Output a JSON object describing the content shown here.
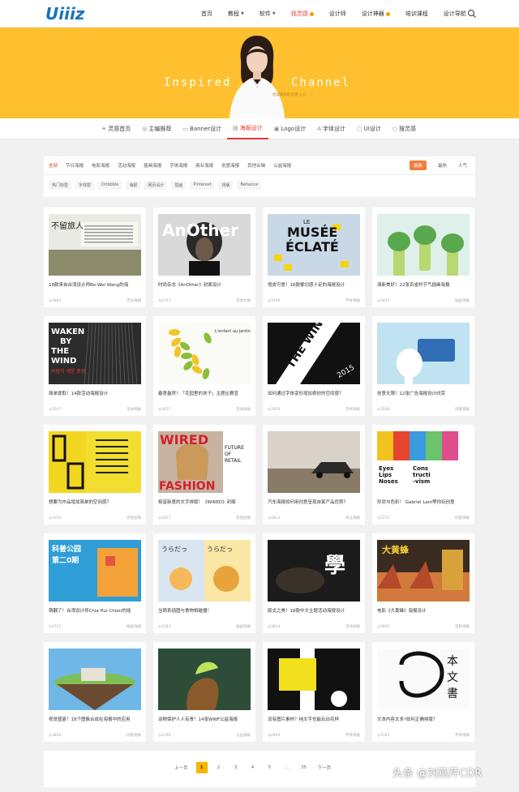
{
  "header": {
    "logo_text": "Uiiiz",
    "nav": [
      {
        "label": "首页",
        "caret": false,
        "badge": false,
        "active": false
      },
      {
        "label": "教程",
        "caret": true,
        "badge": false,
        "active": false
      },
      {
        "label": "软件",
        "caret": true,
        "badge": false,
        "active": false
      },
      {
        "label": "找灵感",
        "caret": false,
        "badge": true,
        "active": true
      },
      {
        "label": "设计师",
        "caret": false,
        "badge": false,
        "active": false
      },
      {
        "label": "设计神器",
        "caret": false,
        "badge": true,
        "active": false
      },
      {
        "label": "培训课程",
        "caret": false,
        "badge": false,
        "active": false
      },
      {
        "label": "设计导航",
        "caret": false,
        "badge": false,
        "active": false
      }
    ],
    "search_icon": "search-icon"
  },
  "banner": {
    "left_text": "Inspired",
    "right_text": "Channel",
    "subtitle": "优设最新的灵感 入口",
    "bg_color": "#fec02f"
  },
  "subnav": [
    {
      "icon": "☀",
      "label": "灵感首页",
      "active": false
    },
    {
      "icon": "◎",
      "label": "主编推荐",
      "active": false
    },
    {
      "icon": "▭",
      "label": "Banner设计",
      "active": false
    },
    {
      "icon": "▤",
      "label": "海报设计",
      "active": true
    },
    {
      "icon": "▣",
      "label": "Logo设计",
      "active": false
    },
    {
      "icon": "A",
      "label": "字体设计",
      "active": false
    },
    {
      "icon": "▢",
      "label": "UI设计",
      "active": false
    },
    {
      "icon": "○",
      "label": "搜灵感",
      "active": false
    }
  ],
  "filter": {
    "tabs": [
      "全部",
      "节日海报",
      "电影海报",
      "活动海报",
      "插画海报",
      "字体海报",
      "商业海报",
      "创意海报",
      "其他合辑",
      "公益海报"
    ],
    "active_tab": 0,
    "sort": [
      "最新",
      "最热",
      "人气"
    ],
    "active_sort": 0,
    "tags": [
      "热门标签",
      "字体帮",
      "Dribbble",
      "海报",
      "网页设计",
      "插画",
      "Pinterest",
      "排版",
      "Behance"
    ]
  },
  "cards": [
    {
      "title": "18款来自台湾设计师Bo-Wei Wang的海",
      "views": "3883",
      "category": "活动海报"
    },
    {
      "title": "时尚杂志《AnOther》封面设计",
      "views": "2743",
      "category": "其他合辑"
    },
    {
      "title": "俏皮可爱！16款紫切感十足的海报设计",
      "views": "3509",
      "category": "字体海报"
    },
    {
      "title": "清新美好！22张百雀羚节气插画海报",
      "views": "3447",
      "category": "插画海报"
    },
    {
      "title": "简单提取！14款活动海报设计",
      "views": "2547",
      "category": "活动海报"
    },
    {
      "title": "春意盎然！「花园里的孩子」主题比赛宣",
      "views": "2827",
      "category": "活动海报"
    },
    {
      "title": "如何通过字体变形增加奇妙的空间感？",
      "views": "2929",
      "category": "字体海报"
    },
    {
      "title": "创意无限！12张广告海报设计欣赏",
      "views": "3508",
      "category": "创意海报"
    },
    {
      "title": "想要为作品增加简单的空间感？",
      "views": "3356",
      "category": "其他合辑"
    },
    {
      "title": "极富新意的文字排版！《WIRED》封面",
      "views": "2827",
      "category": "其他合辑"
    },
    {
      "title": "汽车海报如何用创意呈现自家产品优势？",
      "views": "2813",
      "category": "商业海报"
    },
    {
      "title": "形状与色彩！ Gabriel Lam等你玩创意",
      "views": "2272",
      "category": "创意海报"
    },
    {
      "title": "萌翻了！台湾设计师Chia Hui Chien的插",
      "views": "2721",
      "category": "插画海报"
    },
    {
      "title": "当萌系插图与食物相碰撞！",
      "views": "3383",
      "category": "插画海报"
    },
    {
      "title": "版式之美！18款中文主题活动海报设计",
      "views": "3634",
      "category": "活动海报"
    },
    {
      "title": "电影《大黄蜂》海报设计",
      "views": "2800",
      "category": "电影海报"
    },
    {
      "title": "视觉盛宴！18个图像合成在海报中的应用",
      "views": "3850",
      "category": "创意海报"
    },
    {
      "title": "动物保护人人有责！14张WWF公益海报",
      "views": "2190",
      "category": "公益海报"
    },
    {
      "title": "没有图片素材？纯文字也能玩出花样",
      "views": "2849",
      "category": "字体海报"
    },
    {
      "title": "文本内容太多?如何正确排版？",
      "views": "3183",
      "category": "字体海报"
    }
  ],
  "thumbs": {
    "t1_text": "不留旅人",
    "t2_text": "AnOther",
    "t3_text": [
      "LE",
      "MUSÉE",
      "ÉCLATÉ"
    ],
    "t5_text": [
      "WAKEN",
      "BY",
      "THE",
      "WIND"
    ],
    "t5_sub": "비람이 깨운 풍경",
    "t6_text": "L'enfant au Jardin",
    "t7_text": "THE WIND",
    "t7_year": "2015",
    "t10_text": [
      "WIRED",
      "FASHION"
    ],
    "t10_side": [
      "FUTURE",
      "OF",
      "RETAIL"
    ],
    "t12_text": [
      "Eyes",
      "Lips",
      "Noses"
    ],
    "t12_side": [
      "Cons",
      "tructi",
      "-vism"
    ],
    "t13_text": [
      "科普公园",
      "第二0期"
    ],
    "t14_text": "うらだっ",
    "t15_text": "學",
    "t16_text": "大黄蜂",
    "t20_text": [
      "本",
      "文",
      "書"
    ]
  },
  "pagination": {
    "prev": "上一页",
    "pages": [
      "1",
      "2",
      "3",
      "4",
      "5",
      "...",
      "35"
    ],
    "active": 0,
    "next": "下一页"
  },
  "watermark": "头条 @刘燕芹CDR"
}
